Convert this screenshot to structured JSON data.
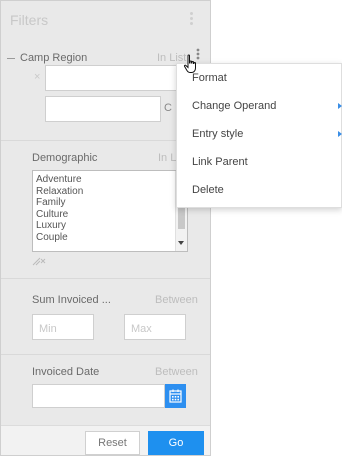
{
  "panel": {
    "title": "Filters"
  },
  "filters": [
    {
      "label": "Camp Region",
      "operator": "In List",
      "clear_symbol": "×"
    },
    {
      "label": "Demographic",
      "operator": "In L",
      "options": [
        "Adventure",
        "Relaxation",
        "Family",
        "Culture",
        "Luxury",
        "Couple"
      ],
      "clear_symbol": "×"
    },
    {
      "label": "Sum Invoiced ...",
      "operator": "Between",
      "min_placeholder": "Min",
      "max_placeholder": "Max"
    },
    {
      "label": "Invoiced Date",
      "operator": "Between",
      "value": ""
    }
  ],
  "context_menu": {
    "items": [
      {
        "label": "Format",
        "has_submenu": false
      },
      {
        "label": "Change Operand",
        "has_submenu": true
      },
      {
        "label": "Entry style",
        "has_submenu": true
      },
      {
        "label": "Link Parent",
        "has_submenu": false
      },
      {
        "label": "Delete",
        "has_submenu": false
      }
    ]
  },
  "footer": {
    "reset_label": "Reset",
    "go_label": "Go"
  },
  "colors": {
    "accent": "#1e90ef",
    "panel_bg": "#e9e9e9"
  }
}
